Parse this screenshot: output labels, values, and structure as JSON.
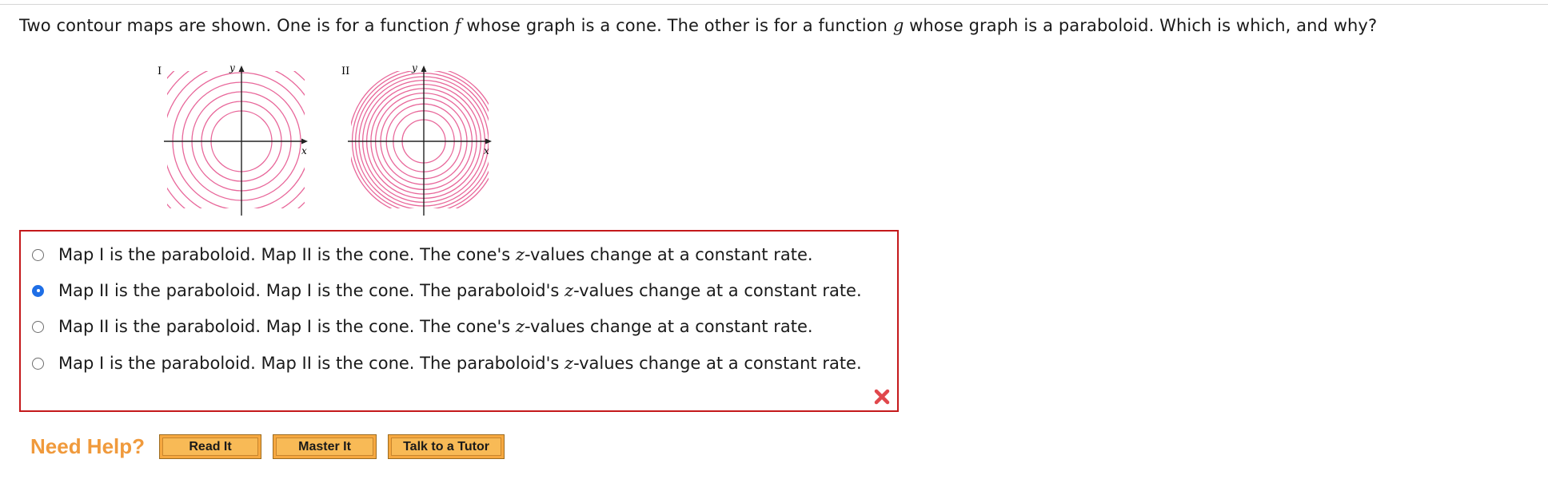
{
  "question": {
    "text_1": "Two contour maps are shown. One is for a function ",
    "var_f": "f",
    "text_2": " whose graph is a cone. The other is for a function ",
    "var_g": "g",
    "text_3": " whose graph is a paraboloid. Which is which, and why?"
  },
  "maps": [
    {
      "label": "I",
      "x_axis": "x",
      "y_axis": "y",
      "contour_color": "#e8679a"
    },
    {
      "label": "II",
      "x_axis": "x",
      "y_axis": "y",
      "contour_color": "#e8679a"
    }
  ],
  "choices": [
    {
      "pre": "Map I is the paraboloid. Map II is the cone. The cone's ",
      "z": "z",
      "post": "-values change at a constant rate.",
      "selected": false
    },
    {
      "pre": "Map II is the paraboloid. Map I is the cone. The paraboloid's ",
      "z": "z",
      "post": "-values change at a constant rate.",
      "selected": true
    },
    {
      "pre": "Map II is the paraboloid. Map I is the cone. The cone's ",
      "z": "z",
      "post": "-values change at a constant rate.",
      "selected": false
    },
    {
      "pre": "Map I is the paraboloid. Map II is the cone. The paraboloid's ",
      "z": "z",
      "post": "-values change at a constant rate.",
      "selected": false
    }
  ],
  "feedback": {
    "icon": "incorrect-x-icon",
    "color": "#e0474c"
  },
  "help": {
    "label": "Need Help?",
    "buttons": [
      "Read It",
      "Master It",
      "Talk to a Tutor"
    ]
  },
  "colors": {
    "answer_border": "#c4191b",
    "radio_selected": "#1f6fe6",
    "help_orange": "#f09a3c"
  }
}
